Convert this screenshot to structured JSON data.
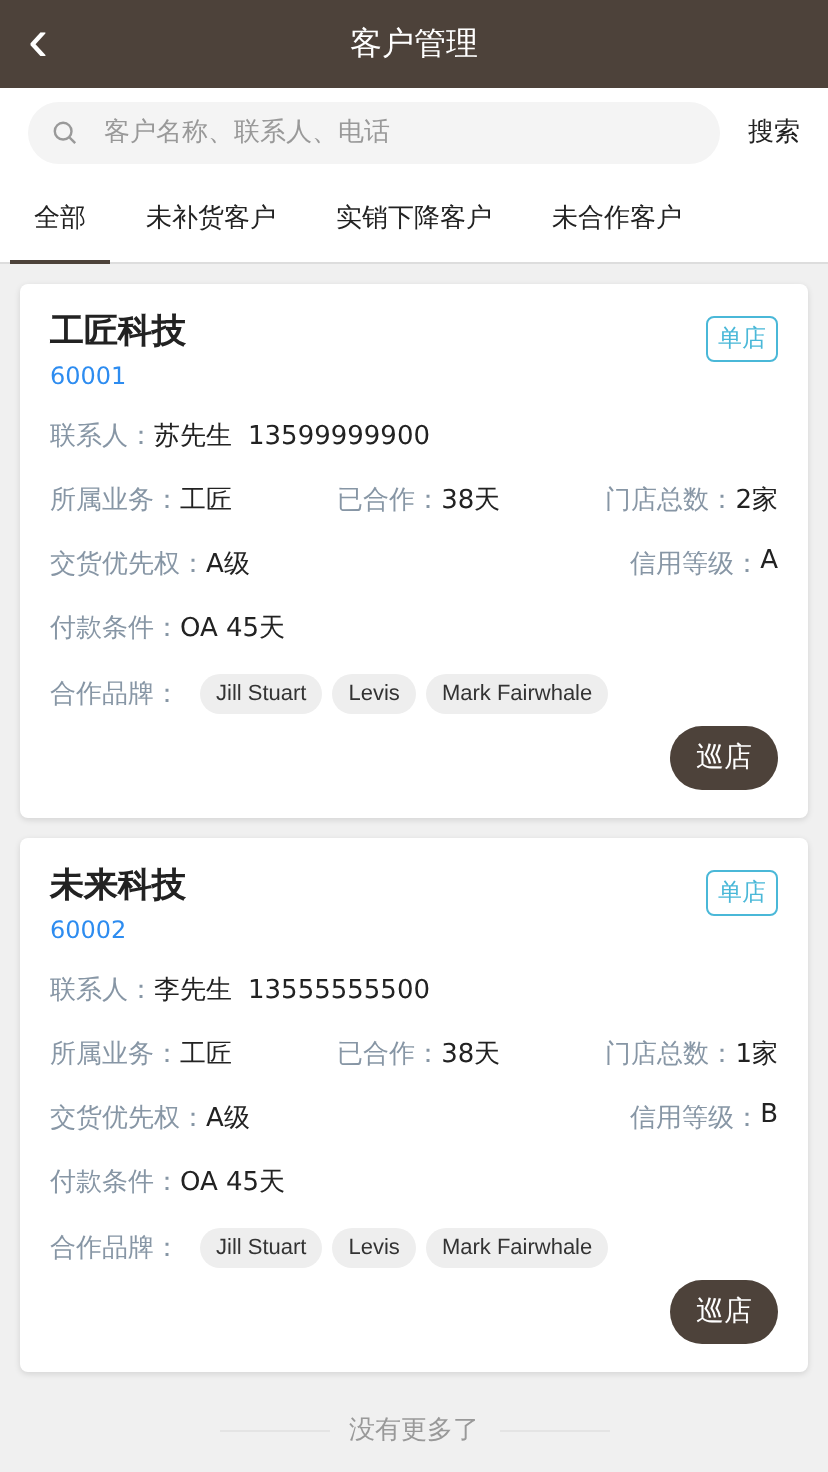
{
  "header": {
    "back_icon": "‹",
    "title": "客户管理"
  },
  "search": {
    "placeholder": "客户名称、联系人、电话",
    "button": "搜索"
  },
  "tabs": [
    {
      "label": "全部",
      "selected": true
    },
    {
      "label": "未补货客户",
      "selected": false
    },
    {
      "label": "实销下降客户",
      "selected": false
    },
    {
      "label": "未合作客户",
      "selected": false
    }
  ],
  "customers": [
    {
      "name": "工匠科技",
      "code": "60001",
      "badge": "单店",
      "contact": {
        "label": "联系人：",
        "person": "苏先生",
        "phone": "13599999900"
      },
      "business": {
        "label": "所属业务：",
        "value": "工匠"
      },
      "cooperated": {
        "label": "已合作：",
        "value": "38天"
      },
      "stores": {
        "label": "门店总数：",
        "value": "2家"
      },
      "priority": {
        "label": "交货优先权：",
        "value": "A级"
      },
      "credit": {
        "label": "信用等级：",
        "value": "A"
      },
      "payment": {
        "label": "付款条件：",
        "value": "OA 45天"
      },
      "brands_label": "合作品牌：",
      "brands": [
        "Jill Stuart",
        "Levis",
        "Mark Fairwhale"
      ],
      "action": "巡店"
    },
    {
      "name": "未来科技",
      "code": "60002",
      "badge": "单店",
      "contact": {
        "label": "联系人：",
        "person": "李先生",
        "phone": "13555555500"
      },
      "business": {
        "label": "所属业务：",
        "value": "工匠"
      },
      "cooperated": {
        "label": "已合作：",
        "value": "38天"
      },
      "stores": {
        "label": "门店总数：",
        "value": "1家"
      },
      "priority": {
        "label": "交货优先权：",
        "value": "A级"
      },
      "credit": {
        "label": "信用等级：",
        "value": "B"
      },
      "payment": {
        "label": "付款条件：",
        "value": "OA 45天"
      },
      "brands_label": "合作品牌：",
      "brands": [
        "Jill Stuart",
        "Levis",
        "Mark Fairwhale"
      ],
      "action": "巡店"
    }
  ],
  "footer": "没有更多了"
}
